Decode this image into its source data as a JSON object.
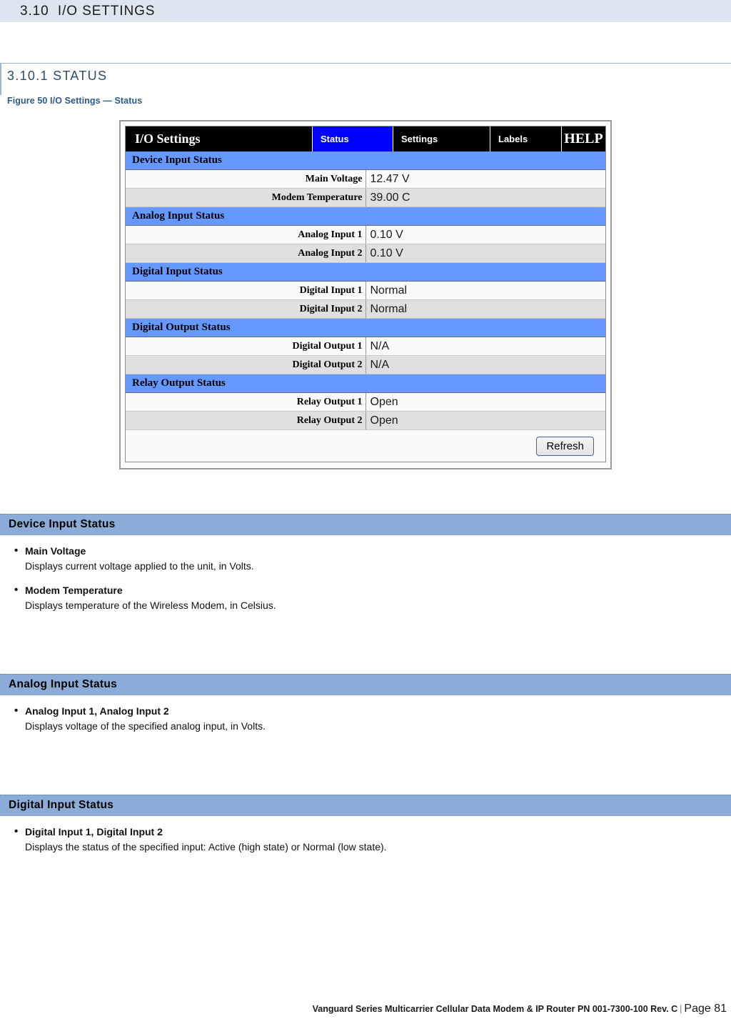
{
  "chapter": {
    "number": "3.10",
    "title": "3.10  I/O SETTINGS"
  },
  "subsection": {
    "title": "3.10.1 STATUS"
  },
  "figure": {
    "caption": "Figure 50 I/O Settings — Status"
  },
  "screenshot": {
    "brand": "I/O Settings",
    "tabs": [
      {
        "label": "Status",
        "active": true
      },
      {
        "label": "Settings",
        "active": false
      },
      {
        "label": "Labels",
        "active": false
      },
      {
        "label": "HELP",
        "active": false
      }
    ],
    "sections": [
      {
        "header": "Device Input Status",
        "rows": [
          {
            "label": "Main Voltage",
            "value": "12.47 V"
          },
          {
            "label": "Modem Temperature",
            "value": "39.00 C"
          }
        ]
      },
      {
        "header": "Analog Input Status",
        "rows": [
          {
            "label": "Analog Input 1",
            "value": "0.10 V"
          },
          {
            "label": "Analog Input 2",
            "value": "0.10 V"
          }
        ]
      },
      {
        "header": "Digital Input Status",
        "rows": [
          {
            "label": "Digital Input 1",
            "value": "Normal"
          },
          {
            "label": "Digital Input 2",
            "value": "Normal"
          }
        ]
      },
      {
        "header": "Digital Output Status",
        "rows": [
          {
            "label": "Digital Output 1",
            "value": "N/A"
          },
          {
            "label": "Digital Output 2",
            "value": "N/A"
          }
        ]
      },
      {
        "header": "Relay Output Status",
        "rows": [
          {
            "label": "Relay Output 1",
            "value": "Open"
          },
          {
            "label": "Relay Output 2",
            "value": "Open"
          }
        ]
      }
    ],
    "refresh_label": "Refresh"
  },
  "descriptions": [
    {
      "header": "Device Input Status",
      "items": [
        {
          "term": "Main Voltage",
          "text": "Displays current voltage applied to the unit, in Volts."
        },
        {
          "term": "Modem Temperature",
          "text": "Displays temperature of the Wireless Modem, in Celsius."
        }
      ]
    },
    {
      "header": "Analog Input Status",
      "items": [
        {
          "term": "Analog Input 1, Analog Input 2",
          "text": "Displays voltage of the specified analog input, in Volts."
        }
      ]
    },
    {
      "header": "Digital Input Status",
      "items": [
        {
          "term": "Digital Input 1, Digital Input 2",
          "text": "Displays the status of the specified input: Active (high state) or Normal (low state)."
        }
      ]
    }
  ],
  "footer": {
    "text": "Vanguard Series Multicarrier Cellular Data Modem & IP Router PN 001-7300-100 Rev. C",
    "separator": "|",
    "page": "Page 81"
  },
  "colors": {
    "chapter_band": "#dce6f1",
    "section_head": "#8cacd8",
    "table_section": "#6699ff",
    "active_tab": "#0000ff",
    "caption": "#2a5a8c",
    "subhead": "#2e4d68"
  }
}
